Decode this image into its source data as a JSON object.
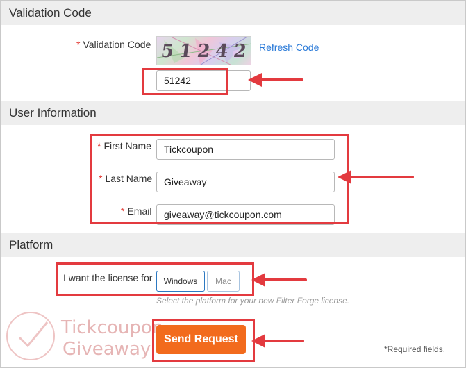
{
  "validation": {
    "section_title": "Validation Code",
    "label": "Validation Code",
    "required_marker": "*",
    "captcha_text": "51242",
    "refresh_label": "Refresh Code",
    "input_value": "51242"
  },
  "user_info": {
    "section_title": "User Information",
    "first_name": {
      "label": "First Name",
      "value": "Tickcoupon"
    },
    "last_name": {
      "label": "Last Name",
      "value": "Giveaway"
    },
    "email": {
      "label": "Email",
      "value": "giveaway@tickcoupon.com"
    },
    "required_marker": "*"
  },
  "platform": {
    "section_title": "Platform",
    "label": "I want the license for",
    "options": [
      "Windows",
      "Mac"
    ],
    "selected": "Windows",
    "hint": "Select the platform for your new Filter Forge license."
  },
  "actions": {
    "submit_label": "Send Request",
    "required_note": "*Required fields."
  },
  "watermark": {
    "line1": "Tickcoupon",
    "line2": "Giveaway"
  },
  "colors": {
    "annotation_red": "#e33a3f",
    "submit_orange": "#f26b1d",
    "link_blue": "#2a7ad8",
    "required_red": "#e2322b",
    "section_gray": "#eeeeee"
  }
}
